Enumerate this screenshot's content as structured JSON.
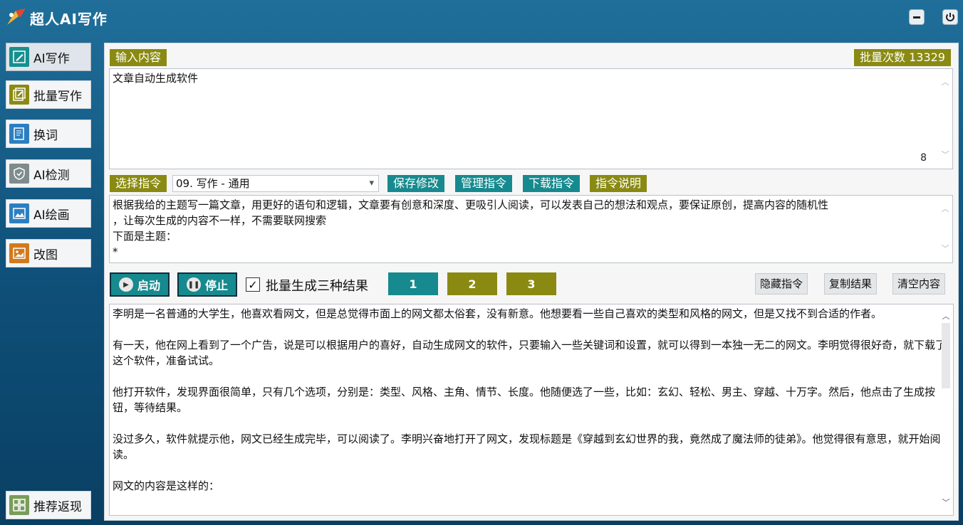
{
  "app": {
    "title": "超人AI写作"
  },
  "sidebar": {
    "items": [
      {
        "label": "AI写作",
        "icon": "edit-icon",
        "color": "#16908f"
      },
      {
        "label": "批量写作",
        "icon": "batch-edit-icon",
        "color": "#8a8a12"
      },
      {
        "label": "换词",
        "icon": "document-icon",
        "color": "#2b7fc1"
      },
      {
        "label": "AI检测",
        "icon": "shield-icon",
        "color": "#7f8c8d"
      },
      {
        "label": "AI绘画",
        "icon": "image-icon",
        "color": "#2b7fc1"
      },
      {
        "label": "改图",
        "icon": "picture-icon",
        "color": "#d07a1e"
      }
    ],
    "bottom": {
      "label": "推荐返现",
      "icon": "grid-icon"
    }
  },
  "input": {
    "label": "输入内容",
    "value": "文章自动生成软件",
    "count": "8",
    "batch_count": "批量次数 13329"
  },
  "command": {
    "label": "选择指令",
    "selected": "09. 写作 - 通用",
    "save": "保存修改",
    "manage": "管理指令",
    "download": "下载指令",
    "help": "指令说明",
    "lines": [
      "根据我给的主题写一篇文章，用更好的语句和逻辑，文章要有创意和深度、更吸引人阅读，可以发表自己的想法和观点，要保证原创，提高内容的随机性",
      "，让每次生成的内容不一样，不需要联网搜索",
      "下面是主题：",
      "*"
    ]
  },
  "controls": {
    "start": "启动",
    "stop": "停止",
    "batch_checkbox": "批量生成三种结果",
    "result_tabs": [
      "1",
      "2",
      "3"
    ],
    "hide": "隐藏指令",
    "copy": "复制结果",
    "clear": "清空内容"
  },
  "result": {
    "paragraphs": [
      "李明是一名普通的大学生，他喜欢看网文，但是总觉得市面上的网文都太俗套，没有新意。他想要看一些自己喜欢的类型和风格的网文，但是又找不到合适的作者。",
      "有一天，他在网上看到了一个广告，说是可以根据用户的喜好，自动生成网文的软件，只要输入一些关键词和设置，就可以得到一本独一无二的网文。李明觉得很好奇，就下载了这个软件，准备试试。",
      "他打开软件，发现界面很简单，只有几个选项，分别是：类型、风格、主角、情节、长度。他随便选了一些，比如：玄幻、轻松、男主、穿越、十万字。然后，他点击了生成按钮，等待结果。",
      "没过多久，软件就提示他，网文已经生成完毕，可以阅读了。李明兴奋地打开了网文，发现标题是《穿越到玄幻世界的我，竟然成了魔法师的徒弟》。他觉得很有意思，就开始阅读。",
      "网文的内容是这样的："
    ]
  },
  "colors": {
    "teal": "#168a8e",
    "olive": "#8a8a12",
    "bg": "#155f8a"
  }
}
